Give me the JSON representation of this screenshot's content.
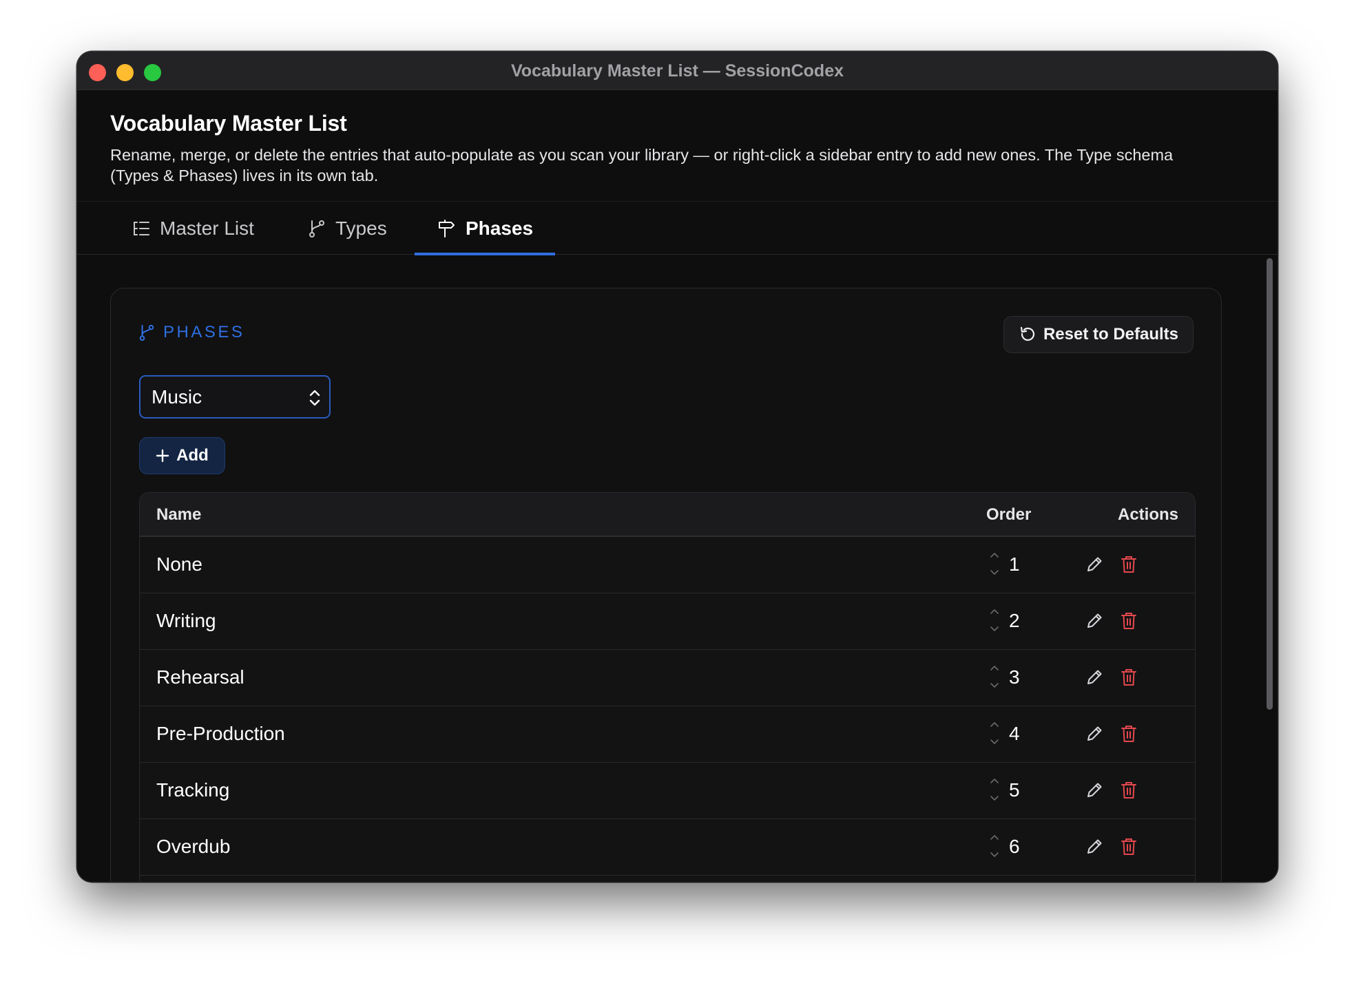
{
  "window": {
    "title": "Vocabulary Master List — SessionCodex"
  },
  "header": {
    "title": "Vocabulary Master List",
    "description": "Rename, merge, or delete the entries that auto-populate as you scan your library — or right-click a sidebar entry to add new ones. The Type schema (Types & Phases) lives in its own tab."
  },
  "tabs": [
    {
      "label": "Master List",
      "icon": "list-tree-icon",
      "active": false
    },
    {
      "label": "Types",
      "icon": "branch-icon",
      "active": false
    },
    {
      "label": "Phases",
      "icon": "signpost-icon",
      "active": true
    }
  ],
  "colors": {
    "accent": "#2f6fe0",
    "danger": "#e5484d",
    "background": "#0e0e0f"
  },
  "section": {
    "label": "PHASES",
    "icon": "branch-icon",
    "reset_label": "Reset to Defaults",
    "type_select": {
      "value": "Music"
    },
    "add_label": "Add"
  },
  "table": {
    "columns": {
      "name": "Name",
      "order": "Order",
      "actions": "Actions"
    },
    "rows": [
      {
        "name": "None",
        "order": "1"
      },
      {
        "name": "Writing",
        "order": "2"
      },
      {
        "name": "Rehearsal",
        "order": "3"
      },
      {
        "name": "Pre-Production",
        "order": "4"
      },
      {
        "name": "Tracking",
        "order": "5"
      },
      {
        "name": "Overdub",
        "order": "6"
      }
    ]
  }
}
